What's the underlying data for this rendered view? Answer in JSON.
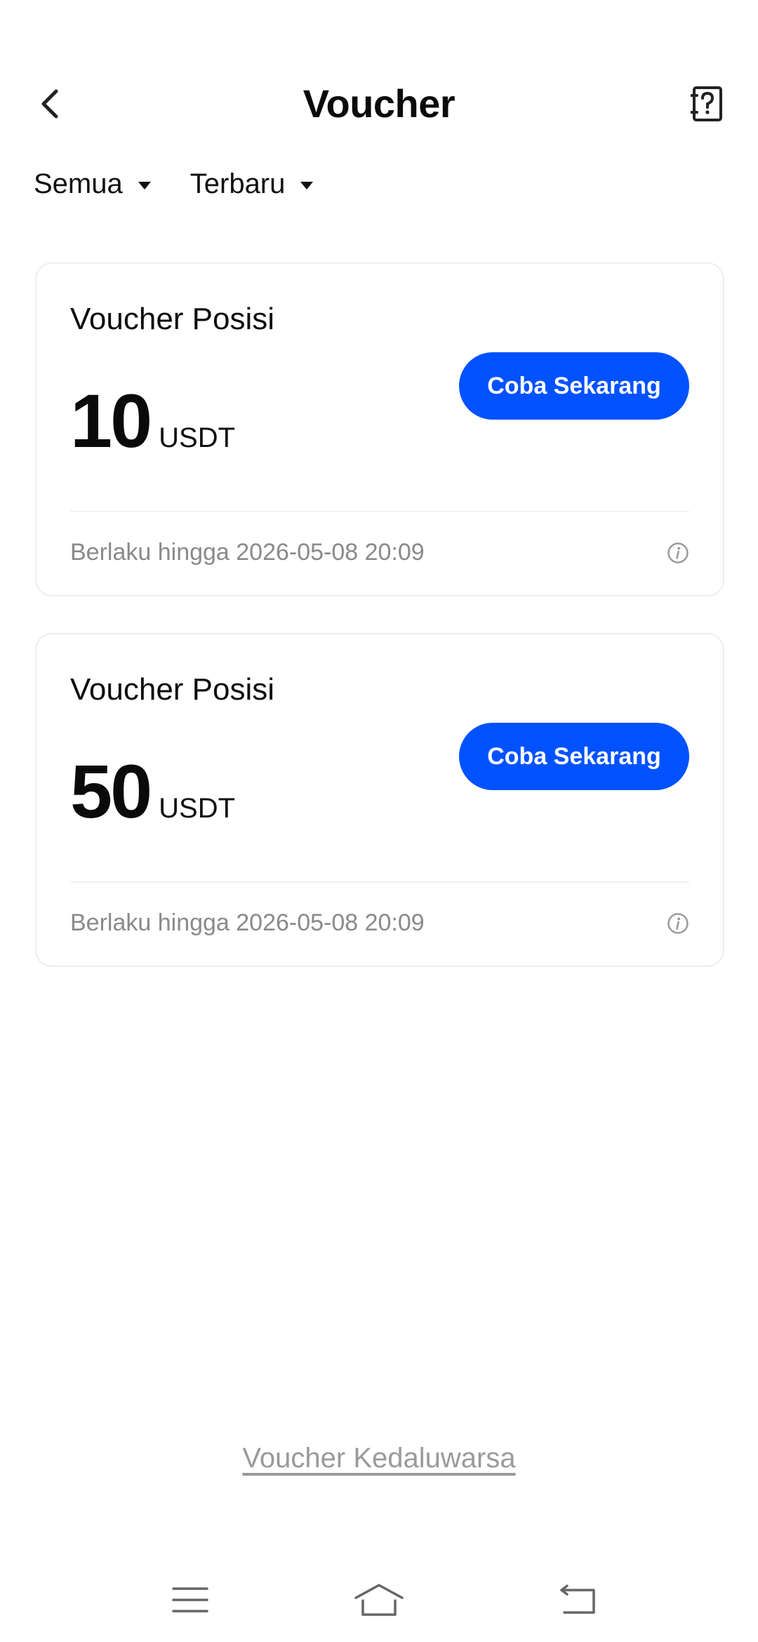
{
  "header": {
    "title": "Voucher",
    "back_icon": "chevron-left-icon",
    "help_icon": "help-book-icon"
  },
  "filters": [
    {
      "label": "Semua"
    },
    {
      "label": "Terbaru"
    }
  ],
  "vouchers": [
    {
      "title": "Voucher Posisi",
      "amount": "10",
      "currency": "USDT",
      "cta": "Coba Sekarang",
      "validity": "Berlaku hingga 2026-05-08 20:09"
    },
    {
      "title": "Voucher Posisi",
      "amount": "50",
      "currency": "USDT",
      "cta": "Coba Sekarang",
      "validity": "Berlaku hingga 2026-05-08 20:09"
    }
  ],
  "footer": {
    "expired_link": "Voucher Kedaluwarsa"
  },
  "colors": {
    "accent": "#0052ff",
    "muted_text": "#8a8a8a"
  }
}
